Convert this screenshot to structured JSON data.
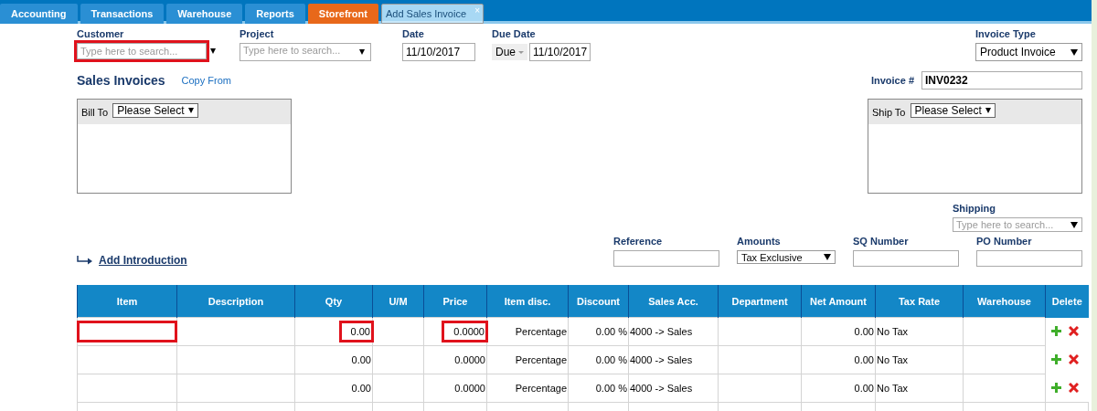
{
  "tabs": [
    {
      "label": "Accounting",
      "kind": "module",
      "selected": false
    },
    {
      "label": "Transactions",
      "kind": "module",
      "selected": false
    },
    {
      "label": "Warehouse",
      "kind": "module",
      "selected": false
    },
    {
      "label": "Reports",
      "kind": "module",
      "selected": false
    },
    {
      "label": "Storefront",
      "kind": "store",
      "selected": false
    },
    {
      "label": "Add Sales Invoice",
      "kind": "document",
      "selected": true,
      "close": "×"
    }
  ],
  "header_fields": [
    {
      "label": "Customer",
      "kind": "combo",
      "placeholder": "Type here to search...",
      "highlighted": true
    },
    {
      "label": "Project",
      "kind": "combo",
      "placeholder": "Type here to search...",
      "highlighted": false
    },
    {
      "label": "Date",
      "kind": "date",
      "value": "11/10/2017",
      "highlighted": false
    },
    {
      "label": "Due Date",
      "kind": "due",
      "prefix": "Due",
      "value": "11/10/2017",
      "highlighted": false
    }
  ],
  "invoice_type": {
    "label": "Invoice Type",
    "value": "Product Invoice"
  },
  "title": "Sales Invoices",
  "copy_from": "Copy From",
  "invoice_number": {
    "label": "Invoice #",
    "value": "INV0232"
  },
  "bill_to": {
    "label": "Bill To",
    "value": "Please Select"
  },
  "ship_to": {
    "label": "Ship To",
    "value": "Please Select"
  },
  "shipping": {
    "label": "Shipping",
    "placeholder": "Type here to search..."
  },
  "add_introduction": "Add Introduction",
  "extra_fields": [
    {
      "label": "Reference",
      "kind": "text"
    },
    {
      "label": "Amounts",
      "kind": "select",
      "value": "Tax Exclusive"
    },
    {
      "label": "SQ Number",
      "kind": "text"
    },
    {
      "label": "PO Number",
      "kind": "text"
    }
  ],
  "table": {
    "columns": [
      "Item",
      "Description",
      "Qty",
      "U/M",
      "Price",
      "Item disc.",
      "Discount",
      "Sales Acc.",
      "Department",
      "Net Amount",
      "Tax Rate",
      "Warehouse",
      "Delete"
    ],
    "rows": [
      {
        "item": "",
        "highlighted": true,
        "description": "",
        "qty": "0.00",
        "um": "",
        "price": "0.0000",
        "item_disc": "Percentage",
        "discount": "0.00 %",
        "sales_acc": "4000 -> Sales",
        "department": "",
        "net_amount": "0.00",
        "tax_rate": "No Tax",
        "warehouse": ""
      },
      {
        "item": "",
        "highlighted": false,
        "description": "",
        "qty": "0.00",
        "um": "",
        "price": "0.0000",
        "item_disc": "Percentage",
        "discount": "0.00 %",
        "sales_acc": "4000 -> Sales",
        "department": "",
        "net_amount": "0.00",
        "tax_rate": "No Tax",
        "warehouse": ""
      },
      {
        "item": "",
        "highlighted": false,
        "description": "",
        "qty": "0.00",
        "um": "",
        "price": "0.0000",
        "item_disc": "Percentage",
        "discount": "0.00 %",
        "sales_acc": "4000 -> Sales",
        "department": "",
        "net_amount": "0.00",
        "tax_rate": "No Tax",
        "warehouse": ""
      }
    ]
  }
}
